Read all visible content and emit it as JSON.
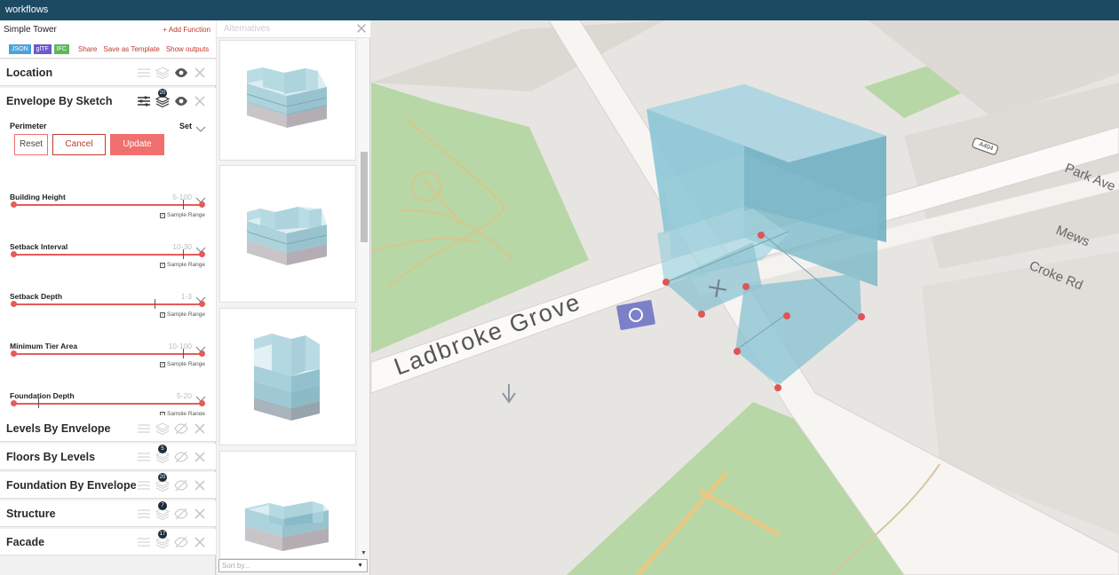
{
  "app": {
    "title": "workflows"
  },
  "project": {
    "name": "Simple Tower",
    "add_function": "+ Add Function",
    "badges": [
      "JSON",
      "glTF",
      "IFC"
    ],
    "links": [
      "Share",
      "Save as Template",
      "Show outputs"
    ]
  },
  "functions": {
    "location": {
      "label": "Location"
    },
    "envelope": {
      "label": "Envelope By Sketch",
      "count": "20",
      "perimeter_label": "Perimeter",
      "perimeter_value": "Set",
      "buttons": {
        "reset": "Reset",
        "cancel": "Cancel",
        "update": "Update"
      },
      "sample_range_label": "Sample Range",
      "params": [
        {
          "label": "Building Height",
          "range": "5-100",
          "value": 0.9
        },
        {
          "label": "Setback Interval",
          "range": "10-30",
          "value": 0.9
        },
        {
          "label": "Setback Depth",
          "range": "1-3",
          "value": 0.75
        },
        {
          "label": "Minimum Tier Area",
          "range": "10-100",
          "value": 0.9
        },
        {
          "label": "Foundation Depth",
          "range": "5-20",
          "value": 0.13
        }
      ]
    },
    "levels": {
      "label": "Levels By Envelope"
    },
    "floors": {
      "label": "Floors By Levels",
      "count": "5"
    },
    "foundation": {
      "label": "Foundation By Envelope",
      "count": "20"
    },
    "structure": {
      "label": "Structure",
      "count": "7"
    },
    "facade": {
      "label": "Facade",
      "count": "17"
    }
  },
  "alternatives": {
    "title": "Alternatives",
    "sort_placeholder": "Sort by..."
  },
  "map": {
    "street_main": "Ladbroke Grove",
    "street_right": "Park Ave",
    "street_lower_right": "Croke Rd",
    "street_mews": "Mews",
    "road_badge": "A404"
  },
  "colors": {
    "topbar": "#1d4a63",
    "accent": "#f07070",
    "building": "#8ac6d6"
  }
}
